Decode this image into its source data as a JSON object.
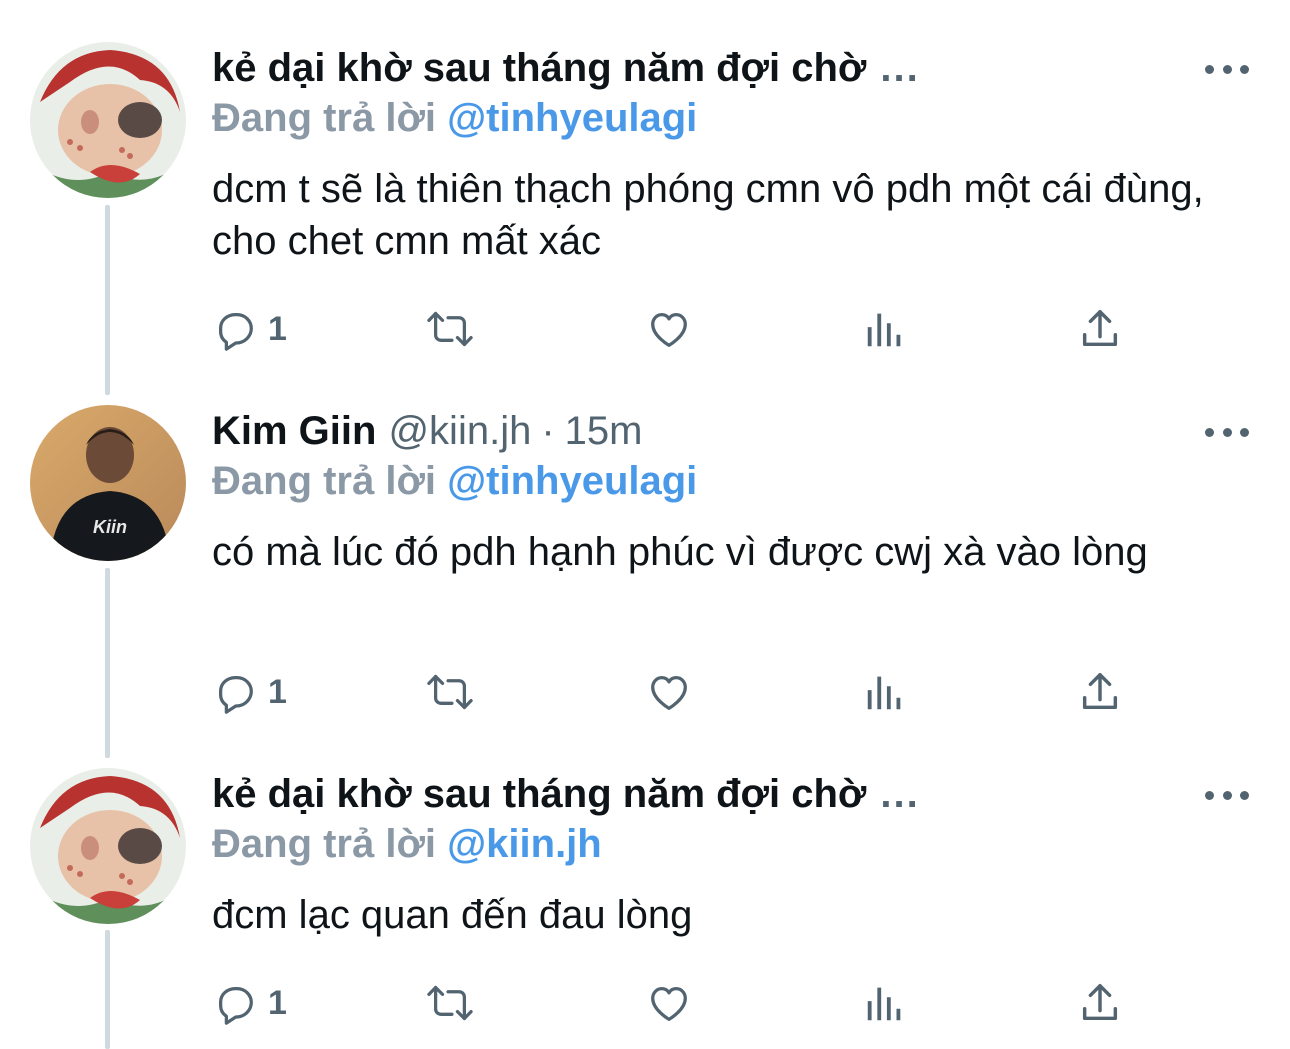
{
  "tweets": [
    {
      "display_name": "kẻ dại khờ sau tháng năm đợi chờ",
      "name_truncation": "...",
      "handle": "",
      "time": "",
      "replying_prefix": "Đang trả lời",
      "replying_to": "@tinhyeulagi",
      "text": "dcm t sẽ là thiên thạch phóng cmn vô pdh một cái đùng, cho chet cmn mất xác",
      "reply_count": "1",
      "avatar": "rose-doll-avatar"
    },
    {
      "display_name": "Kim Giin",
      "name_truncation": "",
      "handle": "@kiin.jh",
      "separator": "·",
      "time": "15m",
      "replying_prefix": "Đang trả lời",
      "replying_to": "@tinhyeulagi",
      "text": "có mà lúc đó pdh hạnh phúc vì được cwj xà vào lòng",
      "reply_count": "1",
      "avatar": "person-jacket-avatar",
      "avatar_jacket_text": "Kiin"
    },
    {
      "display_name": "kẻ dại khờ sau tháng năm đợi chờ",
      "name_truncation": "...",
      "handle": "",
      "time": "",
      "replying_prefix": "Đang trả lời",
      "replying_to": "@kiin.jh",
      "text": "đcm lạc quan đến đau lòng",
      "reply_count": "1",
      "avatar": "rose-doll-avatar"
    }
  ],
  "icons": {
    "reply": "reply-icon",
    "retweet": "retweet-icon",
    "like": "like-icon",
    "views": "views-icon",
    "share": "share-icon",
    "more": "more-icon"
  },
  "colors": {
    "mention": "#4a99e9",
    "muted": "#536471",
    "thread_line": "#cfd9de"
  }
}
